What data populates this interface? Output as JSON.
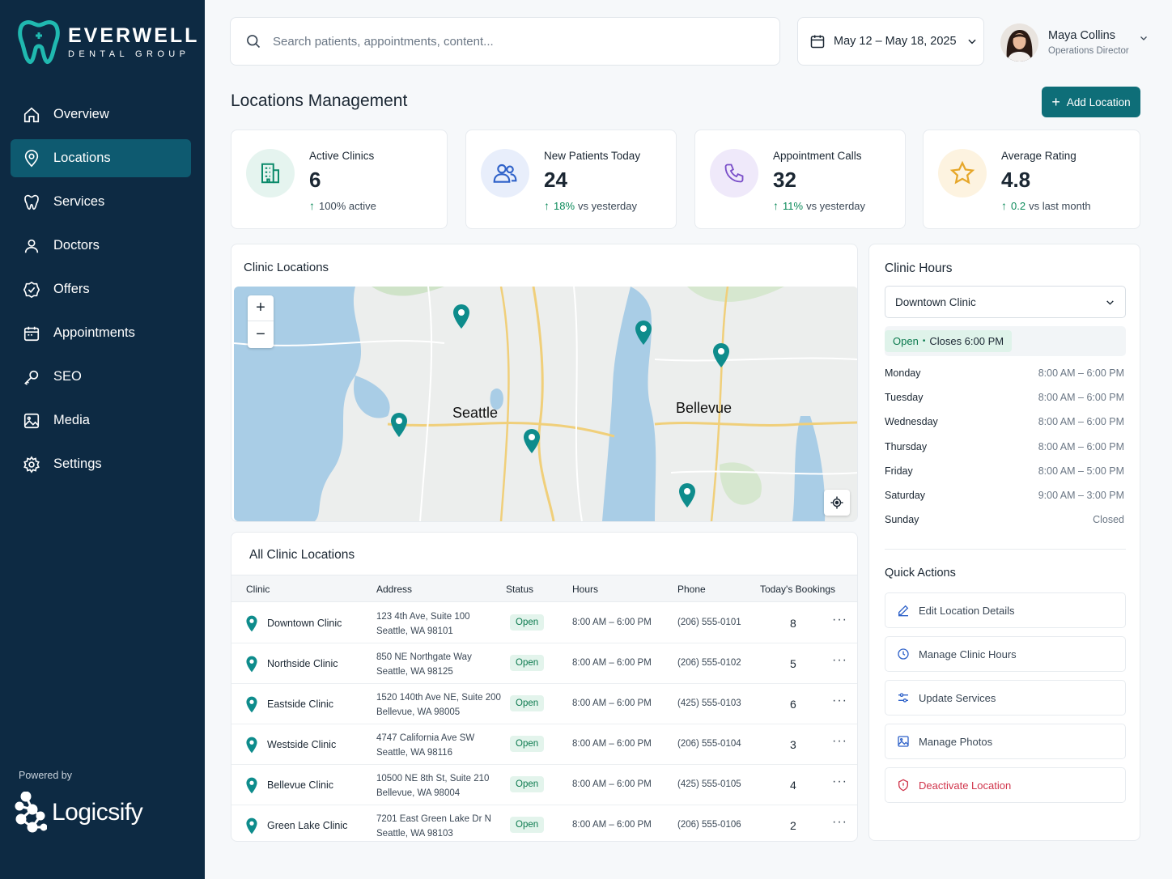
{
  "brand": {
    "name": "EVERWELL",
    "sub": "DENTAL GROUP"
  },
  "sidebar": {
    "items": [
      {
        "label": "Overview",
        "icon": "home-icon"
      },
      {
        "label": "Locations",
        "icon": "map-pin-icon",
        "active": true
      },
      {
        "label": "Services",
        "icon": "tooth-icon"
      },
      {
        "label": "Doctors",
        "icon": "user-icon"
      },
      {
        "label": "Offers",
        "icon": "badge-check-icon"
      },
      {
        "label": "Appointments",
        "icon": "calendar-icon"
      },
      {
        "label": "SEO",
        "icon": "key-icon"
      },
      {
        "label": "Media",
        "icon": "image-icon"
      },
      {
        "label": "Settings",
        "icon": "gear-icon"
      }
    ],
    "powered_by": "Powered by",
    "partner": "Logicsify"
  },
  "header": {
    "search_placeholder": "Search patients, appointments, content...",
    "date_range": "May 12 – May 18, 2025",
    "user": {
      "name": "Maya Collins",
      "role": "Operations Director"
    }
  },
  "page": {
    "title": "Locations Management",
    "add_label": "Add Location"
  },
  "stats": [
    {
      "label": "Active Clinics",
      "value": "6",
      "change": "100% active",
      "pct": "",
      "suffix": "100% active",
      "icon": "building-icon",
      "color": "#0b8a6a",
      "bg": "#e5f4ef"
    },
    {
      "label": "New Patients Today",
      "value": "24",
      "pct": "18%",
      "suffix": "vs yesterday",
      "icon": "users-icon",
      "color": "#2f62c9",
      "bg": "#e8eefb"
    },
    {
      "label": "Appointment Calls",
      "value": "32",
      "pct": "11%",
      "suffix": "vs yesterday",
      "icon": "phone-icon",
      "color": "#7a4fc9",
      "bg": "#efe9fa"
    },
    {
      "label": "Average Rating",
      "value": "4.8",
      "pct": "0.2",
      "suffix": "vs last month",
      "icon": "star-icon",
      "color": "#e6a72a",
      "bg": "#fdf3e0"
    }
  ],
  "map": {
    "title": "Clinic Locations",
    "cities": [
      "Seattle",
      "Bellevue"
    ],
    "zoom_in": "+",
    "zoom_out": "−"
  },
  "table": {
    "title": "All Clinic Locations",
    "columns": [
      "Clinic",
      "Address",
      "Status",
      "Hours",
      "Phone",
      "Today's Bookings"
    ],
    "rows": [
      {
        "clinic": "Downtown Clinic",
        "addr1": "123 4th Ave, Suite 100",
        "addr2": "Seattle, WA 98101",
        "status": "Open",
        "hours": "8:00 AM – 6:00 PM",
        "phone": "(206) 555-0101",
        "bookings": "8"
      },
      {
        "clinic": "Northside Clinic",
        "addr1": "850 NE Northgate Way",
        "addr2": "Seattle, WA 98125",
        "status": "Open",
        "hours": "8:00 AM – 6:00 PM",
        "phone": "(206) 555-0102",
        "bookings": "5"
      },
      {
        "clinic": "Eastside Clinic",
        "addr1": "1520 140th Ave NE, Suite 200",
        "addr2": "Bellevue, WA 98005",
        "status": "Open",
        "hours": "8:00 AM – 6:00 PM",
        "phone": "(425) 555-0103",
        "bookings": "6"
      },
      {
        "clinic": "Westside Clinic",
        "addr1": "4747 California Ave SW",
        "addr2": "Seattle, WA 98116",
        "status": "Open",
        "hours": "8:00 AM – 6:00 PM",
        "phone": "(206) 555-0104",
        "bookings": "3"
      },
      {
        "clinic": "Bellevue Clinic",
        "addr1": "10500 NE 8th St, Suite 210",
        "addr2": "Bellevue, WA 98004",
        "status": "Open",
        "hours": "8:00 AM – 6:00 PM",
        "phone": "(425) 555-0105",
        "bookings": "4"
      },
      {
        "clinic": "Green Lake Clinic",
        "addr1": "7201 East Green Lake Dr N",
        "addr2": "Seattle, WA 98103",
        "status": "Open",
        "hours": "8:00 AM – 6:00 PM",
        "phone": "(206) 555-0106",
        "bookings": "2"
      }
    ],
    "more": "···"
  },
  "clinic_hours": {
    "title": "Clinic Hours",
    "selected": "Downtown Clinic",
    "status_open": "Open",
    "status_close": "Closes 6:00 PM",
    "days": [
      {
        "day": "Monday",
        "time": "8:00 AM – 6:00 PM"
      },
      {
        "day": "Tuesday",
        "time": "8:00 AM – 6:00 PM"
      },
      {
        "day": "Wednesday",
        "time": "8:00 AM – 6:00 PM"
      },
      {
        "day": "Thursday",
        "time": "8:00 AM – 6:00 PM"
      },
      {
        "day": "Friday",
        "time": "8:00 AM – 5:00 PM"
      },
      {
        "day": "Saturday",
        "time": "9:00 AM – 3:00 PM"
      },
      {
        "day": "Sunday",
        "time": "Closed"
      }
    ]
  },
  "quick_actions": {
    "title": "Quick Actions",
    "items": [
      {
        "label": "Edit Location Details",
        "icon": "pencil-icon"
      },
      {
        "label": "Manage Clinic Hours",
        "icon": "clock-icon"
      },
      {
        "label": "Update Services",
        "icon": "sliders-icon"
      },
      {
        "label": "Manage Photos",
        "icon": "image-icon"
      },
      {
        "label": "Deactivate Location",
        "icon": "shield-off-icon",
        "danger": true
      }
    ]
  },
  "colors": {
    "sidebar": "#0d2a43",
    "accent": "#0e6e78",
    "pin": "#0e8c8c",
    "open": "#0b7a4e"
  }
}
